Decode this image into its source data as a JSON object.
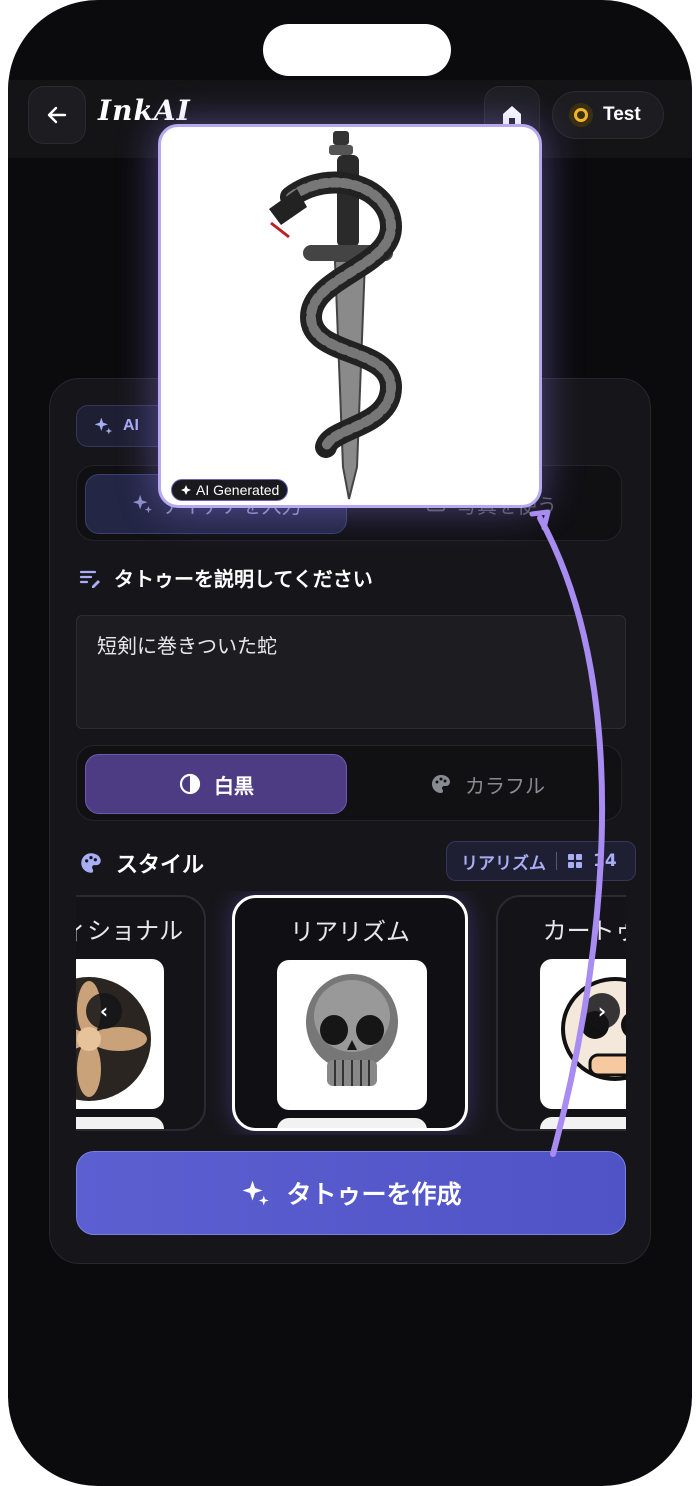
{
  "app": {
    "logo": "InkAI",
    "user_name": "Test"
  },
  "ai_badge": "AI",
  "mode_tabs": [
    {
      "label": "アイデアを入力",
      "active": true
    },
    {
      "label": "写真を使う",
      "active": false
    }
  ],
  "prompt": {
    "heading": "タトゥーを説明してください",
    "value": "短剣に巻きついた蛇"
  },
  "tone": {
    "options": [
      {
        "label": "白黒",
        "icon": "contrast-icon",
        "active": true
      },
      {
        "label": "カラフル",
        "icon": "palette-icon",
        "active": false
      }
    ]
  },
  "styles": {
    "heading": "スタイル",
    "selected_chip": "リアリズム",
    "count": "14",
    "items": [
      {
        "label": "トラディショナル",
        "selected": false
      },
      {
        "label": "リアリズム",
        "selected": true
      },
      {
        "label": "カートゥーン",
        "selected": false
      }
    ]
  },
  "create_button": "タトゥーを作成",
  "preview": {
    "tag": "AI Generated"
  },
  "colors": {
    "accent": "#5b5fd0",
    "tone_active": "#4d3c84",
    "glow": "#b8a8f0"
  }
}
